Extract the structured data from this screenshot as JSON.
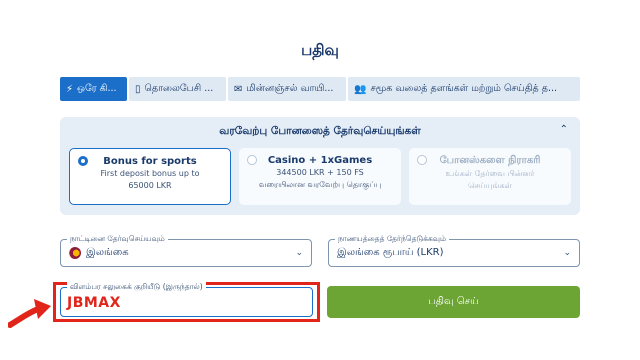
{
  "title": "பதிவு",
  "tabs": [
    {
      "label": "ஒரே கி...",
      "icon": "lightning-icon",
      "active": true
    },
    {
      "label": "தொலைபேசி ...",
      "icon": "phone-icon",
      "active": false
    },
    {
      "label": "மின்னஞ்சல் வாயி...",
      "icon": "envelope-icon",
      "active": false
    },
    {
      "label": "சமூக வலைத் தளங்கள் மற்றும் செய்தித் த...",
      "icon": "people-icon",
      "active": false
    }
  ],
  "bonus": {
    "heading": "வரவேற்பு போனஸைத் தேர்வுசெய்யுங்கள்",
    "options": [
      {
        "title": "Bonus for sports",
        "line1": "First deposit bonus up to",
        "line2": "65000 LKR",
        "selected": true
      },
      {
        "title": "Casino + 1xGames",
        "line1": "344500 LKR + 150 FS",
        "line2": "வரையிலான வரவேற்பு தொகுப்பு",
        "selected": false
      },
      {
        "title": "போனஸ்களை நிராகரி",
        "line1": "உங்கள் தேர்வை பின்னர்",
        "line2": "செய்யுங்கள்",
        "selected": false
      }
    ]
  },
  "country": {
    "label": "நாட்டினை தேர்வுசெய்யவும்",
    "value": "இலங்கை"
  },
  "currency": {
    "label": "நாணயத்தைத் தேர்ந்தெடுக்கவும்",
    "value": "இலங்கை ரூபாய் (LKR)"
  },
  "promo": {
    "label": "விளம்பர சலுகைக் குறியீடு (இருந்தால்)",
    "value": "JBMAX"
  },
  "submit_label": "பதிவு செய்",
  "colors": {
    "accent": "#1c6fc9",
    "submit": "#6ca534",
    "highlight": "#e1251b"
  }
}
